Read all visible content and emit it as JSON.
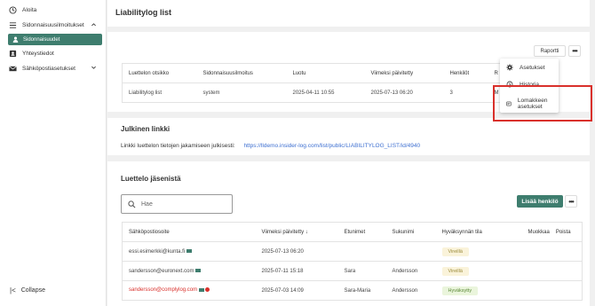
{
  "sidebar": {
    "items": [
      {
        "label": "Aloita"
      },
      {
        "label": "Sidonnaisuusilmoitukset"
      },
      {
        "label": "Sidonnaisuudet"
      },
      {
        "label": "Yhteystiedot"
      },
      {
        "label": "Sähköpostiasetukset"
      }
    ],
    "collapse_label": "Collapse"
  },
  "header": {
    "title": "Liabilitylog list"
  },
  "toolbar": {
    "report_label": "Raportti",
    "more_label": "•••"
  },
  "list_table": {
    "headers": [
      "Luettelon otsikko",
      "Sidonnaisuusilmoitus",
      "Luotu",
      "Viimeksi päivitetty",
      "Henkilöt",
      "R"
    ],
    "row": [
      "Liabilitylog list",
      "system",
      "2025-04-11 10:55",
      "2025-07-13 06:20",
      "3",
      "M"
    ]
  },
  "dropdown": {
    "items": [
      {
        "label": "Asetukset"
      },
      {
        "label": "Historia"
      },
      {
        "label": "Lomakkeen asetukset"
      }
    ]
  },
  "public_link": {
    "title": "Julkinen linkki",
    "text": "Linkki luettelon tietojen jakamiseen julkisesti:",
    "url": "https://lldemo.insider-log.com/list/public/LIABILITYLOG_LIST/id/4940"
  },
  "members": {
    "title": "Luettelo jäsenistä",
    "search_placeholder": "Hae",
    "add_label": "Lisää henkilö",
    "more_label": "•••",
    "headers": [
      "Sähköpostiosoite",
      "Viimeksi päivitetty ↓",
      "Etunimet",
      "Sukunimi",
      "Hyväksynnän tila",
      "Muokkaa",
      "Poista"
    ],
    "rows": [
      {
        "email": "essi.esimerkki@kunta.fi",
        "updated": "2025-07-13 06:20",
        "first": "",
        "last": "",
        "status": "Vireillä"
      },
      {
        "email": "sandersson@euronext.com",
        "updated": "2025-07-11 15:18",
        "first": "Sara",
        "last": "Andersson",
        "status": "Vireillä"
      },
      {
        "email": "sandersson@complylog.com",
        "updated": "2025-07-03 14:09",
        "first": "Sara-Maria",
        "last": "Andersson",
        "status": "Hyväksytty"
      }
    ]
  },
  "colors": {
    "accent": "#3e7d6e",
    "pending_bg": "#faf3da",
    "pending_fg": "#9a8a3a",
    "approved_bg": "#eaf5dc",
    "approved_fg": "#5d8a3a",
    "error_email": "#d9302b",
    "highlight": "#d9302b"
  }
}
